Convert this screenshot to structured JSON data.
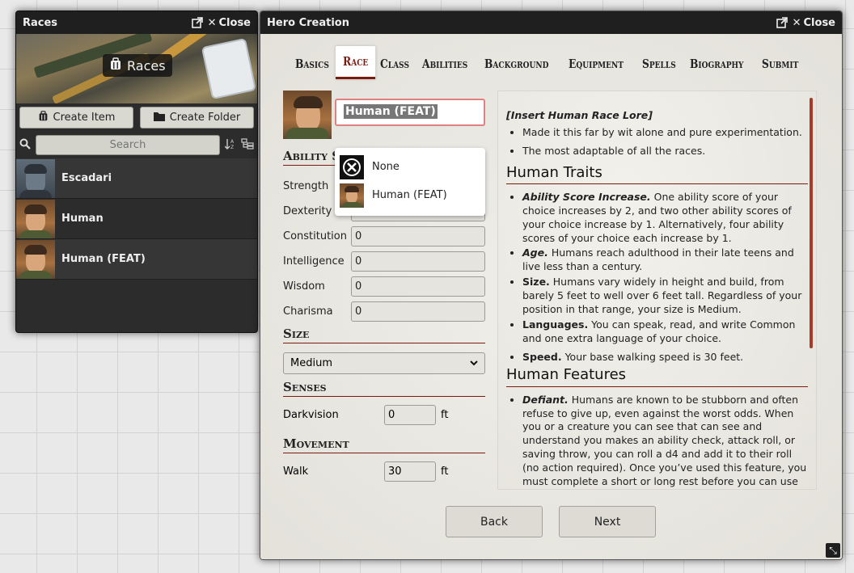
{
  "races_window": {
    "title": "Races",
    "close_label": "Close",
    "banner_label": "Races",
    "create_item_label": "Create Item",
    "create_folder_label": "Create Folder",
    "search_placeholder": "Search",
    "items": [
      {
        "label": "Escadari",
        "icon": "beast-portrait"
      },
      {
        "label": "Human",
        "icon": "human-portrait"
      },
      {
        "label": "Human (FEAT)",
        "icon": "human-portrait"
      }
    ]
  },
  "hero_window": {
    "title": "Hero Creation",
    "close_label": "Close",
    "tabs": [
      {
        "label": "Basics"
      },
      {
        "label": "Race",
        "active": true
      },
      {
        "label": "Class"
      },
      {
        "label": "Abilities"
      },
      {
        "label": "Background"
      },
      {
        "label": "Equipment"
      },
      {
        "label": "Spells"
      },
      {
        "label": "Biography"
      },
      {
        "label": "Submit"
      }
    ],
    "race_select_value": "Human (FEAT)",
    "dropdown_options": [
      {
        "label": "None",
        "icon": "none-icon"
      },
      {
        "label": "Human (FEAT)",
        "icon": "human-portrait"
      }
    ],
    "ability_head": "Ability Sco",
    "abilities": [
      {
        "label": "Strength",
        "value": ""
      },
      {
        "label": "Dexterity",
        "value": "0"
      },
      {
        "label": "Constitution",
        "value": "0"
      },
      {
        "label": "Intelligence",
        "value": "0"
      },
      {
        "label": "Wisdom",
        "value": "0"
      },
      {
        "label": "Charisma",
        "value": "0"
      }
    ],
    "size_head": "Size",
    "size_value": "Medium",
    "senses_head": "Senses",
    "darkvision_label": "Darkvision",
    "darkvision_value": "0",
    "movement_head": "Movement",
    "walk_label": "Walk",
    "walk_value": "30",
    "unit_ft": "ft",
    "lore": {
      "insert": "[Insert Human Race Lore]",
      "intro": [
        "Made it this far by wit alone and pure experimentation.",
        "The most adaptable of all the races."
      ],
      "traits_head": "Human Traits",
      "traits": [
        {
          "term": "Ability Score Increase.",
          "text": " One ability score of your choice increases by 2, and two other ability scores of your choice increase by 1. Alternatively, four ability scores of your choice each increase by 1."
        },
        {
          "term": "Age.",
          "text": " Humans reach adulthood in their late teens and live less than a century."
        },
        {
          "term": "Size.",
          "text": " Humans vary widely in height and build, from barely 5 feet to well over 6 feet tall. Regardless of your position in that range, your size is Medium."
        },
        {
          "term": "Languages.",
          "text": " You can speak, read, and write Common and one extra language of your choice."
        },
        {
          "term": "Speed.",
          "text": " Your base walking speed is 30 feet."
        }
      ],
      "features_head": "Human Features",
      "features": [
        {
          "term": "Defiant.",
          "text": " Humans are known to be stubborn and often refuse to give up, even against the worst odds. When you or a creature you can see that can see and understand you makes an ability check, attack roll, or saving throw, you can roll a d4 and add it to their roll (no action required). Once you’ve used this feature, you must complete a short or long rest before you can use it again."
        }
      ]
    },
    "back_label": "Back",
    "next_label": "Next"
  }
}
